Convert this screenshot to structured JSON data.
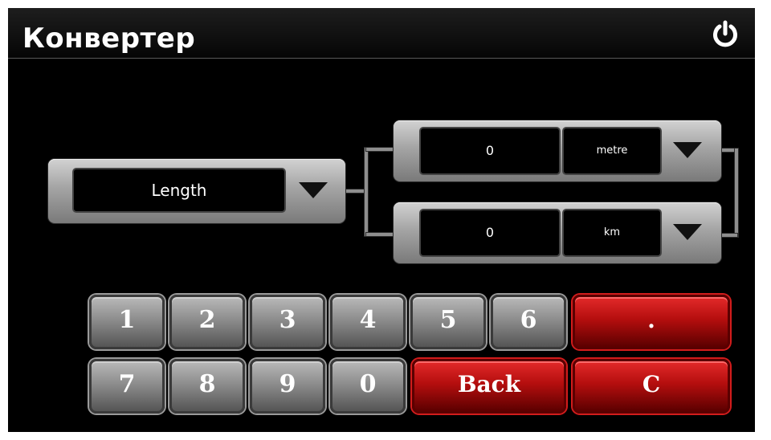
{
  "app": {
    "title": "Конвертер",
    "power_icon": "power-icon"
  },
  "converter": {
    "category": "Length",
    "from": {
      "value": "0",
      "unit": "metre"
    },
    "to": {
      "value": "0",
      "unit": "km"
    }
  },
  "keypad": {
    "row1": [
      "1",
      "2",
      "3",
      "4",
      "5",
      "6"
    ],
    "row2": [
      "7",
      "8",
      "9",
      "0"
    ],
    "dot_label": ".",
    "back_label": "Back",
    "clear_label": "C"
  },
  "colors": {
    "accent": "#c01010",
    "background": "#000000",
    "button_gray": "#8d8d8d"
  }
}
